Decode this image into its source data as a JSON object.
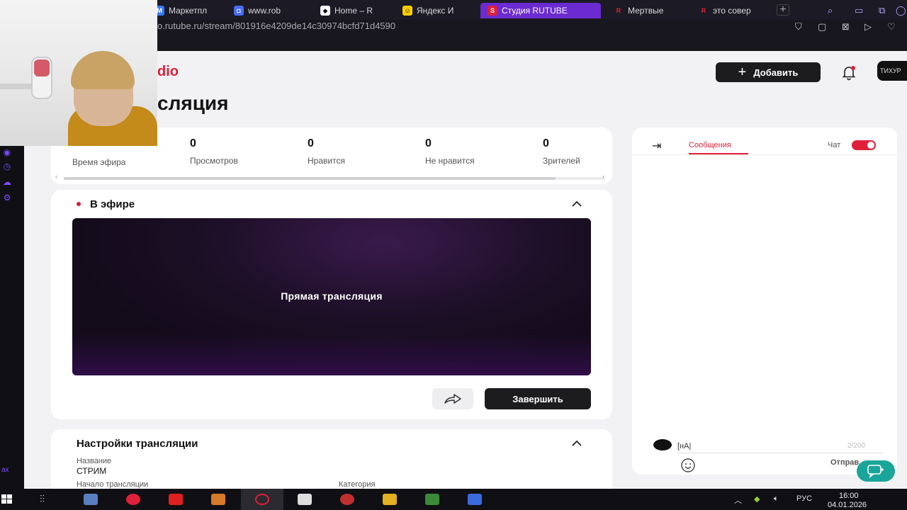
{
  "browser": {
    "tabs": [
      {
        "label": "Маркетпл",
        "fav_color": "#3a7bff",
        "fav_glyph": "M"
      },
      {
        "label": "www.rob",
        "fav_color": "#4a6cff",
        "fav_glyph": "◘"
      },
      {
        "label": "Home – R",
        "fav_color": "#ffffff",
        "fav_glyph": "◆"
      },
      {
        "label": "Яндекс И",
        "fav_color": "#ffcc00",
        "fav_glyph": "☺"
      },
      {
        "label": "Студия RUTUBE",
        "fav_color": "#e0203a",
        "fav_glyph": "S"
      },
      {
        "label": "Мертвые",
        "fav_color": "#1c1a24",
        "fav_glyph": "R"
      },
      {
        "label": "это совер",
        "fav_color": "#1c1a24",
        "fav_glyph": "R"
      }
    ],
    "new_tab": "+",
    "url": "o.rutube.ru/stream/801916e4209de14c30974bcfd71d4590"
  },
  "header": {
    "brand": "dio",
    "page_title": "сляция",
    "add_button": "Добавить",
    "avatar_text": "ТИХУР"
  },
  "stats": {
    "items": [
      {
        "value": "",
        "label": "Время эфира"
      },
      {
        "value": "0",
        "label": "Просмотров"
      },
      {
        "value": "0",
        "label": "Нравится"
      },
      {
        "value": "0",
        "label": "Не нравится"
      },
      {
        "value": "0",
        "label": "Зрителей"
      }
    ]
  },
  "live": {
    "label": "В эфире",
    "player_text": "Прямая трансляция",
    "end_button": "Завершить"
  },
  "settings": {
    "title": "Настройки трансляции",
    "name_label": "Название",
    "name_value": "СТРИМ",
    "start_label": "Начало трансляции",
    "category_label": "Категория"
  },
  "chat": {
    "tab_messages": "Сообщения",
    "toggle_label": "Чат",
    "input_value": "[нА|",
    "counter": "2/200",
    "send_label": "Отправ"
  },
  "rail": {
    "bottom_text": "аx"
  },
  "taskbar": {
    "lang": "РУС",
    "time": "16:00",
    "date": "04.01.2026"
  },
  "colors": {
    "accent": "#e0203a",
    "browser_active_tab": "#6b2bd1",
    "support": "#1aa59a"
  }
}
